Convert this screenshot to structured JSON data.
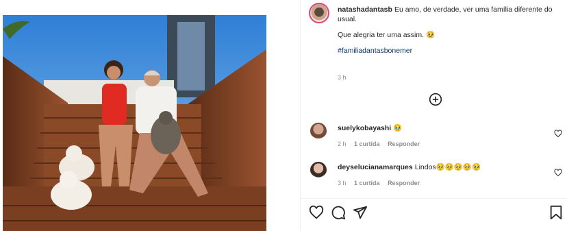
{
  "post": {
    "author": "natashadantasb",
    "caption_line1": "Eu amo, de verdade, ver uma família diferente do usual.",
    "caption_line2": "Que alegria ter uma assim. 🥹",
    "hashtag": "#familiadantasbonemer",
    "time": "3 h"
  },
  "load_more_icon": "plus-circle-icon",
  "comments": [
    {
      "user": "suelykobayashi",
      "text": "🥹",
      "time": "2 h",
      "likes": "1 curtida",
      "reply": "Responder"
    },
    {
      "user": "deyselucianamarques",
      "text": "Lindos🥹🥹🥹🥹🥹",
      "time": "3 h",
      "likes": "1 curtida",
      "reply": "Responder"
    }
  ],
  "actions": [
    "heart-icon",
    "comment-icon",
    "share-icon",
    "bookmark-icon"
  ],
  "colors": {
    "text": "#262626",
    "muted": "#8e8e8e",
    "hashtag": "#00376b",
    "story_ring": "#e0437e",
    "divider": "#efefef"
  }
}
